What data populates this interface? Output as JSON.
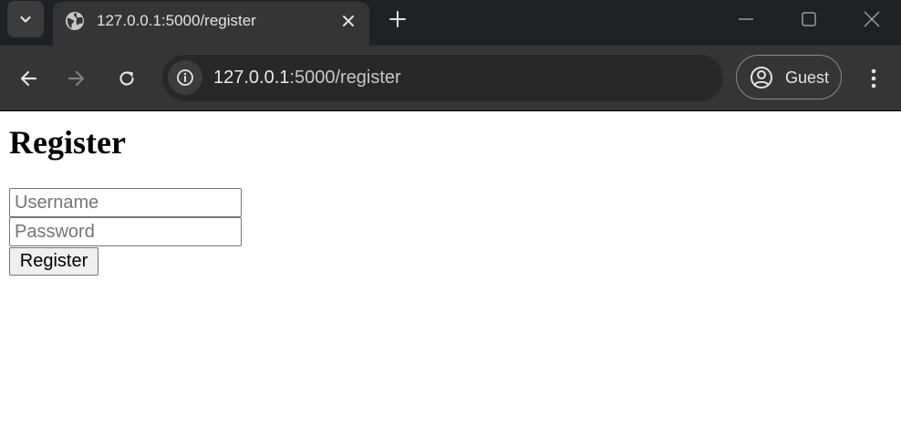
{
  "browser": {
    "tab": {
      "title": "127.0.0.1:5000/register",
      "favicon": "globe-icon"
    },
    "address_bar": {
      "host": "127.0.0.1",
      "path": ":5000/register"
    },
    "profile": {
      "label": "Guest"
    },
    "colors": {
      "tabstrip": "#202124",
      "toolbar": "#353535",
      "omnibox": "#282828"
    }
  },
  "page": {
    "heading": "Register",
    "form": {
      "username_placeholder": "Username",
      "password_placeholder": "Password",
      "submit_label": "Register"
    }
  }
}
